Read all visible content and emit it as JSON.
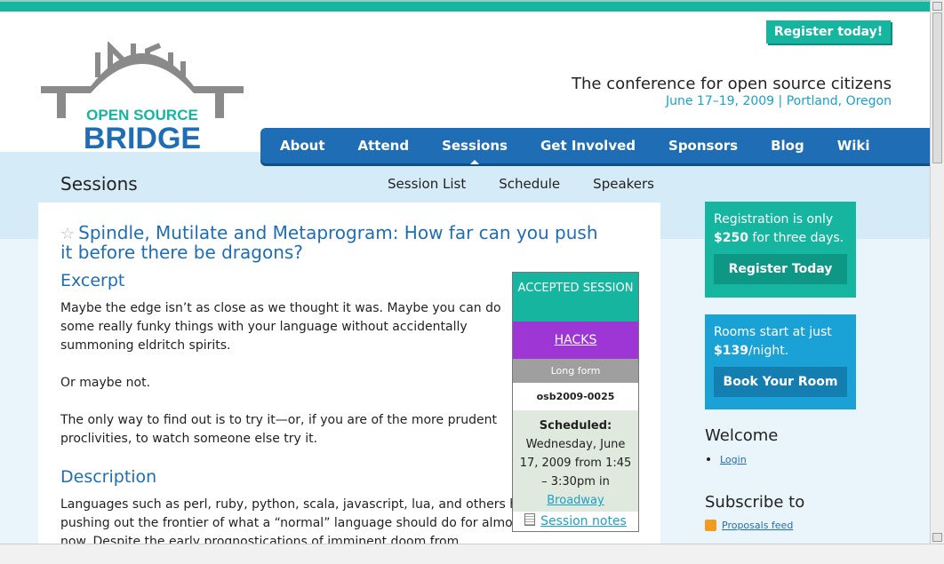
{
  "header": {
    "register_top": "Register today!",
    "logo_top": "OPEN SOURCE",
    "logo_bottom": "BRIDGE",
    "tagline": "The conference for open source citizens",
    "dateline": "June 17–19, 2009 | Portland, Oregon"
  },
  "nav": {
    "items": [
      "About",
      "Attend",
      "Sessions",
      "Get Involved",
      "Sponsors",
      "Blog",
      "Wiki"
    ],
    "active": "Sessions"
  },
  "subheader": {
    "title": "Sessions",
    "links": [
      "Session List",
      "Schedule",
      "Speakers"
    ]
  },
  "session": {
    "title": "Spindle, Mutilate and Metaprogram: How far can you push it before there be dragons?",
    "excerpt_heading": "Excerpt",
    "excerpt_p1": "Maybe the edge isn’t as close as we thought it was. Maybe you can do some really funky things with your language without accidentally summoning eldritch spirits.",
    "excerpt_p2": "Or maybe not.",
    "excerpt_p3": "The only way to find out is to try it—or, if you are of the more prudent proclivities, to watch someone else try it.",
    "description_heading": "Description",
    "description_p1": "Languages such as perl, ruby, python, scala, javascript, lua, and others have been steadily pushing out the frontier of what a “normal” language should do for almost two decades now. Despite the early prognostications of imminent doom from"
  },
  "status_box": {
    "accepted": "ACCEPTED SESSION",
    "track": "HACKS",
    "form": "Long form",
    "code": "osb2009-0025",
    "scheduled_label": "Scheduled:",
    "scheduled_text": "Wednesday, June 17, 2009 from 1:45 – 3:30pm in",
    "room": "Broadway",
    "notes": "Session notes"
  },
  "sidebar": {
    "promo1_text_a": "Registration is only",
    "promo1_price": "$250",
    "promo1_text_b": "for three days.",
    "promo1_button": "Register Today",
    "promo2_text_a": "Rooms start at just",
    "promo2_price": "$139",
    "promo2_text_b": "/night.",
    "promo2_button": "Book Your Room",
    "welcome_heading": "Welcome",
    "login_link": "Login",
    "subscribe_heading": "Subscribe to",
    "feed_link": "Proposals feed"
  },
  "colors": {
    "teal": "#15b59f",
    "blue": "#1f6eb5",
    "purple": "#9e36d6",
    "light_band": "#d6ebf8"
  }
}
